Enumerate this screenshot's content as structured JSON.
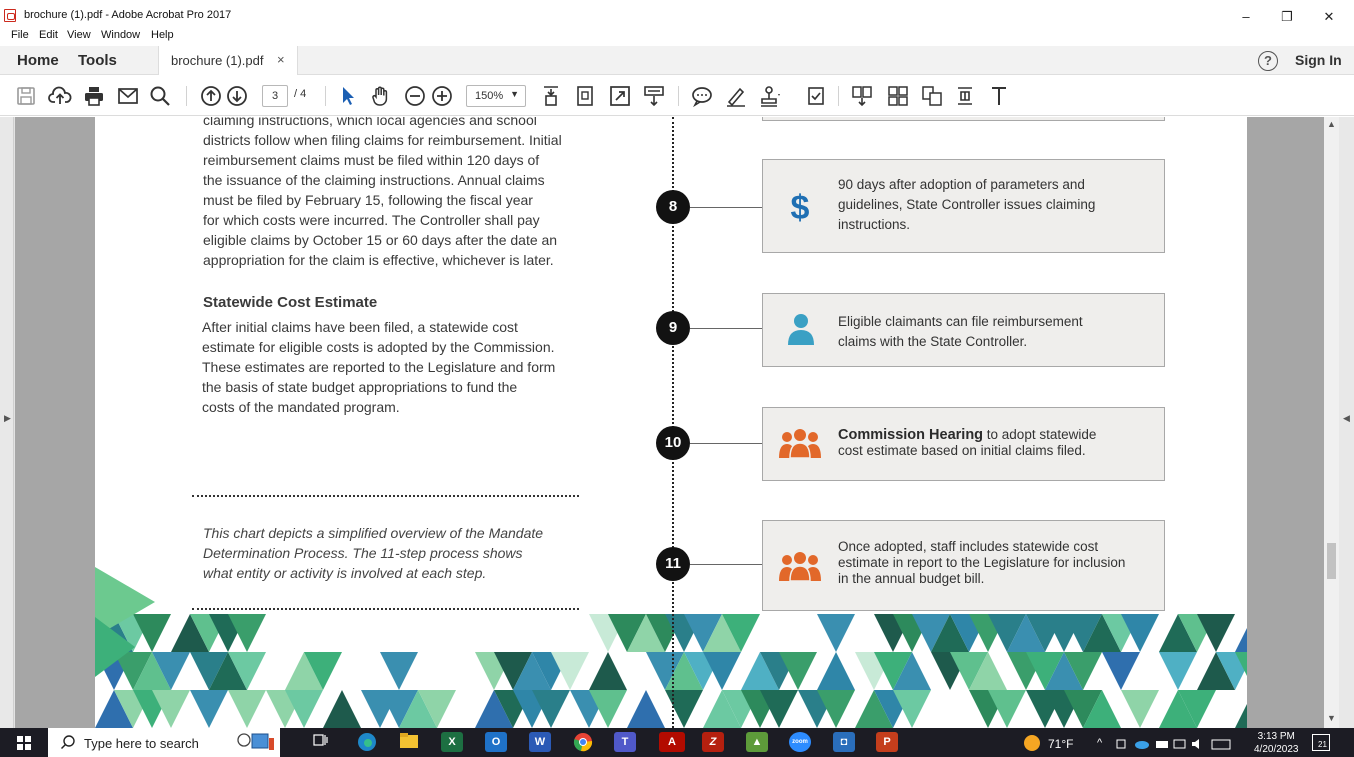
{
  "window": {
    "title": "brochure (1).pdf - Adobe Acrobat Pro 2017",
    "minimize": "–",
    "restore": "❐",
    "close": "✕"
  },
  "menu": [
    "File",
    "Edit",
    "View",
    "Window",
    "Help"
  ],
  "tabs": {
    "home": "Home",
    "tools": "Tools",
    "document": "brochure (1).pdf",
    "close": "×",
    "help": "?",
    "signin": "Sign In"
  },
  "toolbar": {
    "page_current": "3",
    "page_total": "/ 4",
    "zoom": "150%",
    "icons": [
      "save-icon",
      "upload-icon",
      "print-icon",
      "email-icon",
      "search-icon",
      "page-up-icon",
      "page-down-icon",
      "select-arrow-icon",
      "hand-icon",
      "zoom-out-icon",
      "zoom-in-icon",
      "fit-page-icon",
      "fit-width-icon",
      "fullscreen-icon",
      "scroll-mode-icon",
      "comment-icon",
      "highlight-icon",
      "sign-icon",
      "fill-sign-icon",
      "export-icon",
      "organize-icon",
      "combine-icon",
      "compare-icon",
      "text-icon"
    ]
  },
  "document": {
    "intro_lines": [
      "claiming instructions, which local agencies and school",
      "districts follow when filing claims for reimbursement. Initial",
      "reimbursement claims must be filed within 120 days of",
      "the issuance of the claiming instructions. Annual claims",
      "must be filed by February 15, following the fiscal year",
      "for which costs were incurred. The Controller shall pay",
      "eligible claims by October 15 or 60 days after the date an",
      "appropriation for the claim is effective, whichever is later."
    ],
    "heading": "Statewide Cost Estimate",
    "estimate_lines": [
      "After initial claims have been filed, a statewide cost",
      "estimate for eligible costs is adopted by the Commission.",
      "These estimates are reported to the Legislature and form",
      "the basis of state budget appropriations to fund the",
      "costs of the mandated program."
    ],
    "note_lines": [
      "This chart depicts a simplified overview of the Mandate",
      "Determination Process. The 11-step process shows",
      "what entity or activity is involved at each step."
    ],
    "steps": [
      {
        "number": "8",
        "icon": "dollar-icon",
        "color": "#1f6fb3",
        "lines": [
          "90 days after adoption of parameters and",
          "guidelines, State Controller issues claiming",
          "instructions."
        ]
      },
      {
        "number": "9",
        "icon": "person-icon",
        "color": "#3aa0c4",
        "lines": [
          "Eligible claimants can file reimbursement",
          "claims with the State Controller."
        ]
      },
      {
        "number": "10",
        "icon": "group-icon",
        "color": "#e2682a",
        "bold": "Commission Hearing",
        "lines": [
          " to adopt statewide",
          "cost estimate based on initial claims filed."
        ]
      },
      {
        "number": "11",
        "icon": "group-icon",
        "color": "#e2682a",
        "lines": [
          "Once adopted, staff includes statewide cost",
          "estimate in report to the Legislature for inclusion",
          "in the annual budget bill."
        ]
      }
    ]
  },
  "taskbar": {
    "search_placeholder": "Type here to search",
    "weather": "71°F",
    "time": "3:13 PM",
    "date": "4/20/2023",
    "notifications": "21"
  }
}
